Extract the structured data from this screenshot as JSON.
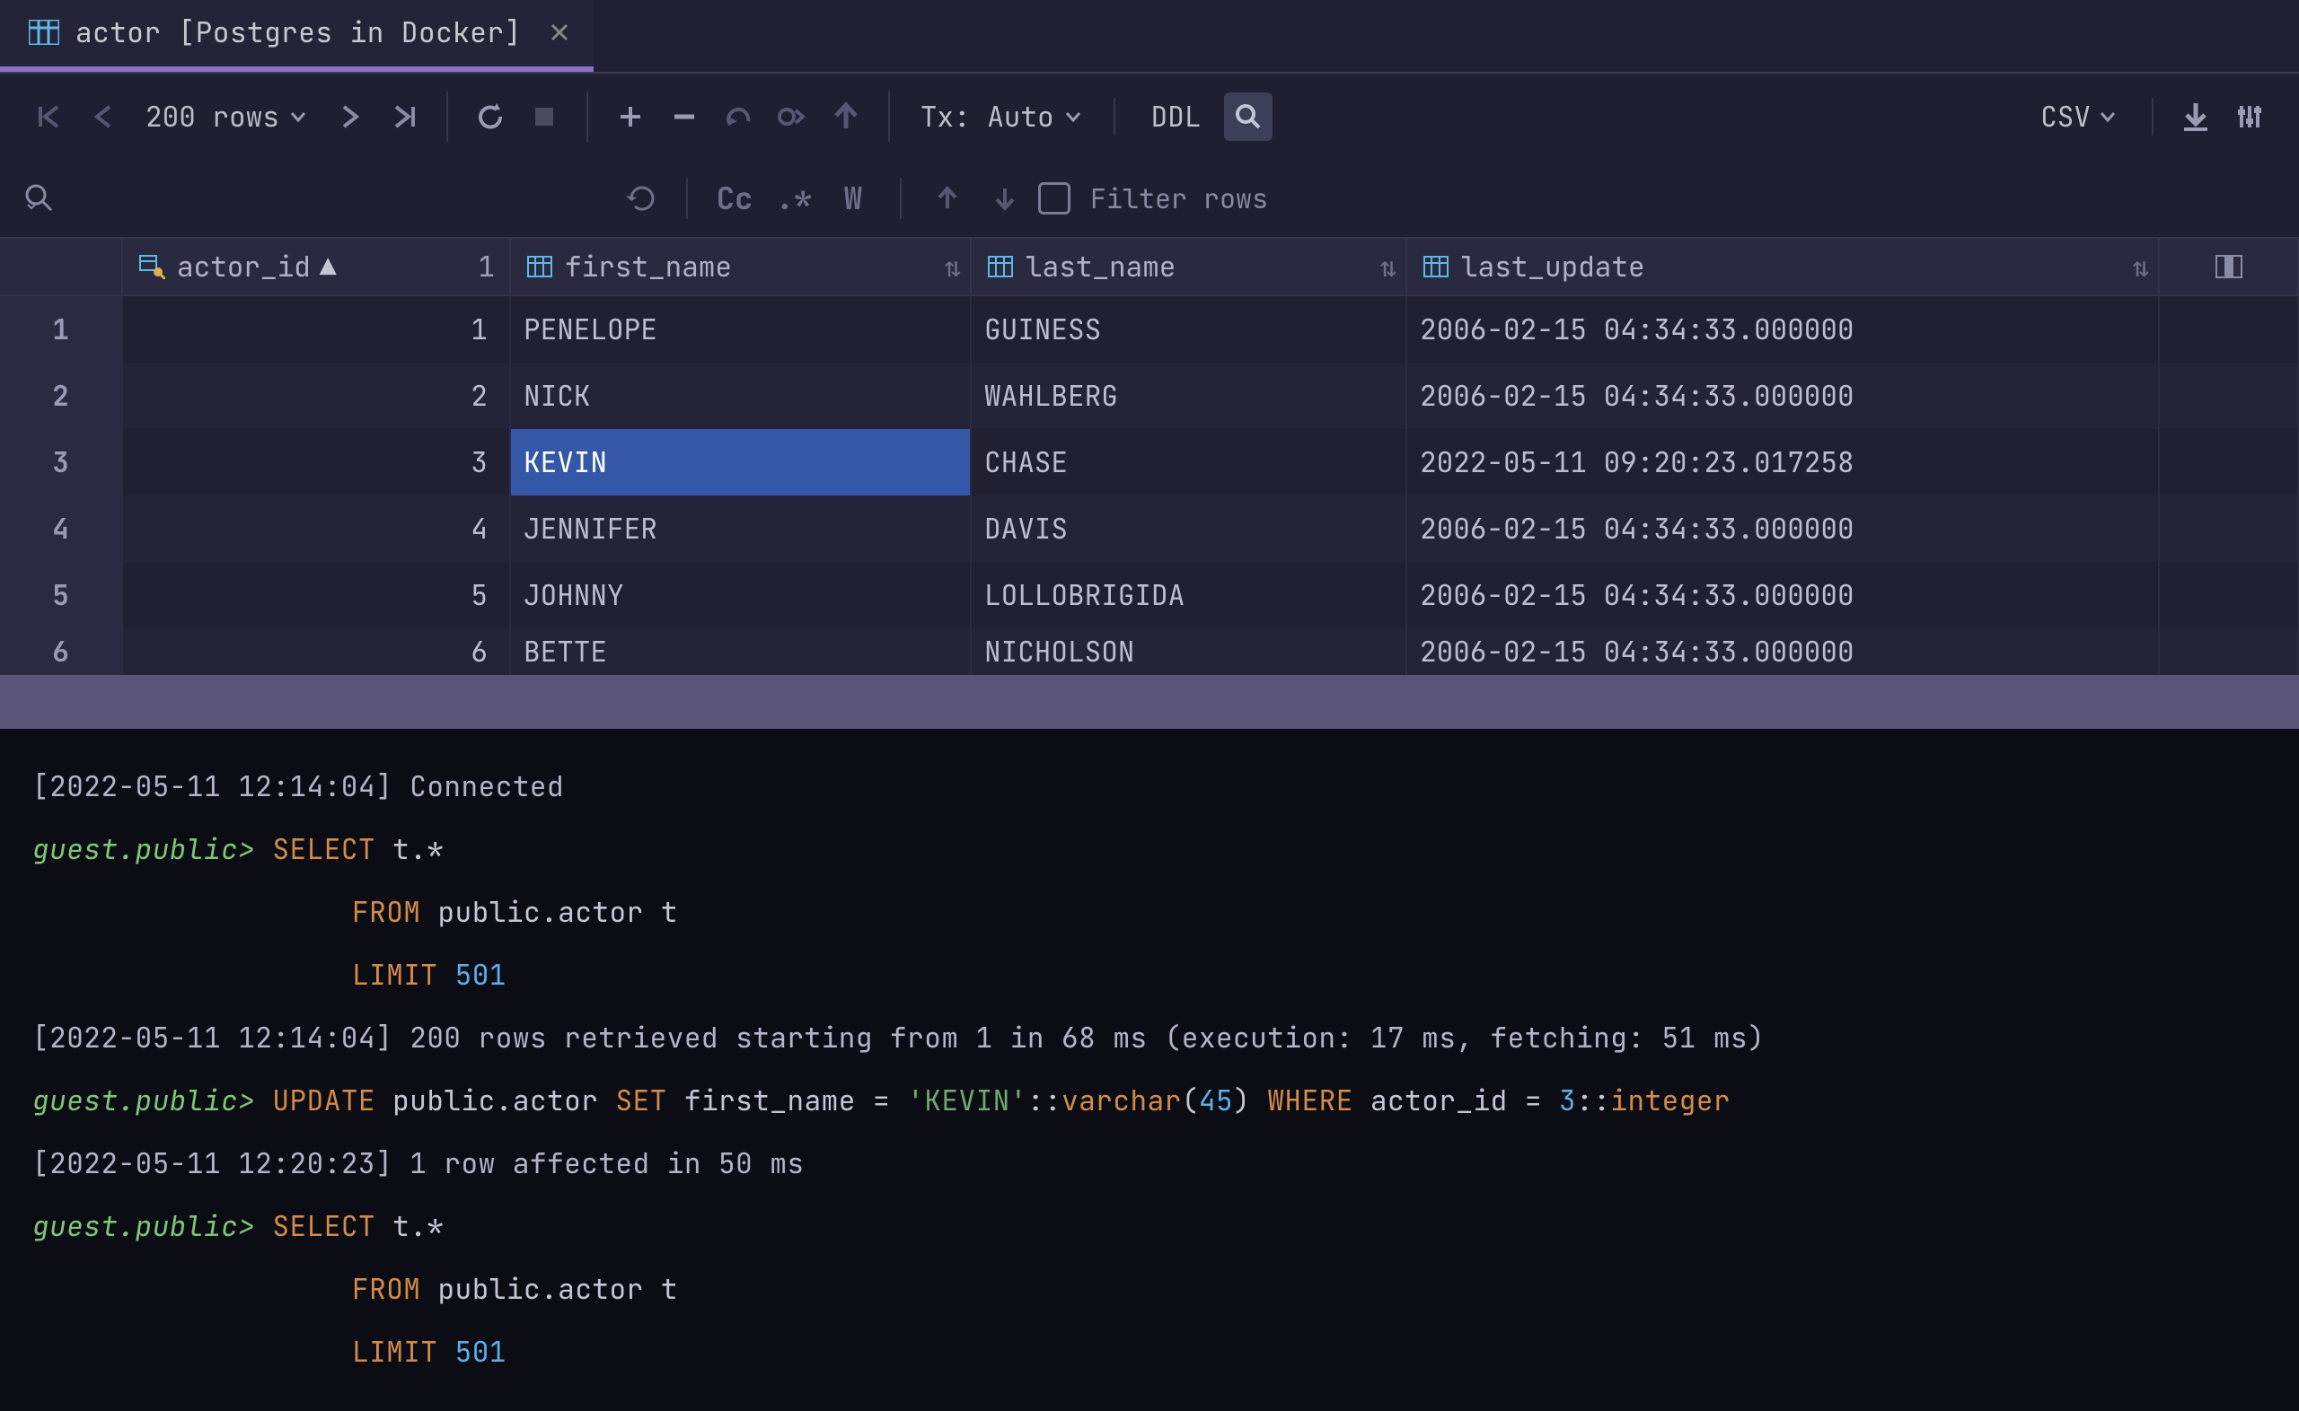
{
  "tab": {
    "title": "actor [Postgres in Docker]"
  },
  "toolbar": {
    "rows_label": "200 rows",
    "tx_auto": "Tx: Auto",
    "ddl": "DDL",
    "csv": "CSV"
  },
  "filter": {
    "placeholder": "Filter rows"
  },
  "columns": {
    "actor_id": "actor_id",
    "first_name": "first_name",
    "last_name": "last_name",
    "last_update": "last_update",
    "sort_index": "1"
  },
  "rows": [
    {
      "n": "1",
      "actor_id": "1",
      "first_name": "PENELOPE",
      "last_name": "GUINESS",
      "last_update": "2006-02-15 04:34:33.000000"
    },
    {
      "n": "2",
      "actor_id": "2",
      "first_name": "NICK",
      "last_name": "WAHLBERG",
      "last_update": "2006-02-15 04:34:33.000000"
    },
    {
      "n": "3",
      "actor_id": "3",
      "first_name": "KEVIN",
      "last_name": "CHASE",
      "last_update": "2022-05-11 09:20:23.017258"
    },
    {
      "n": "4",
      "actor_id": "4",
      "first_name": "JENNIFER",
      "last_name": "DAVIS",
      "last_update": "2006-02-15 04:34:33.000000"
    },
    {
      "n": "5",
      "actor_id": "5",
      "first_name": "JOHNNY",
      "last_name": "LOLLOBRIGIDA",
      "last_update": "2006-02-15 04:34:33.000000"
    },
    {
      "n": "6",
      "actor_id": "6",
      "first_name": "BETTE",
      "last_name": "NICHOLSON",
      "last_update": "2006-02-15 04:34:33.000000"
    }
  ],
  "selected": {
    "row": 2,
    "col": "first_name"
  },
  "console": {
    "l1_ts": "[2022-05-11 12:14:04]",
    "l1_msg": "Connected",
    "prompt": "guest.public>",
    "sel1_a": "SELECT",
    "sel1_b": "t.*",
    "sel1_from": "FROM",
    "sel1_table": "public.actor t",
    "sel1_limit": "LIMIT",
    "sel1_num": "501",
    "l2_ts": "[2022-05-11 12:14:04]",
    "l2_msg": "200 rows retrieved starting from 1 in 68 ms (execution: 17 ms, fetching: 51 ms)",
    "upd_kw1": "UPDATE",
    "upd_tbl": "public.actor",
    "upd_set": "SET",
    "upd_col": "first_name =",
    "upd_str": "'KEVIN'",
    "upd_cast1": "::",
    "upd_vc": "varchar",
    "upd_vc_n": "45",
    "upd_where": "WHERE",
    "upd_wcol": "actor_id =",
    "upd_wn": "3",
    "upd_cast2": "::",
    "upd_int": "integer",
    "l3_ts": "[2022-05-11 12:20:23]",
    "l3_msg": "1 row affected in 50 ms"
  }
}
